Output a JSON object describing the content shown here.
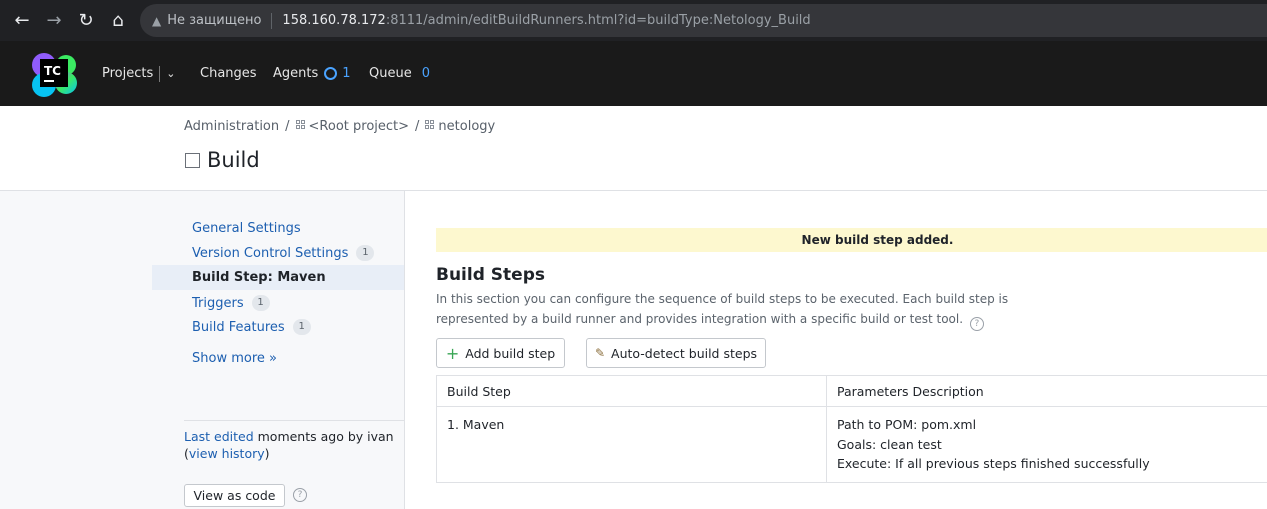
{
  "browser": {
    "insecure_label": "Не защищено",
    "url_host": "158.160.78.172",
    "url_rest": ":8111/admin/editBuildRunners.html?id=buildType:Netology_Build"
  },
  "header": {
    "logo_text": "TC",
    "projects": "Projects",
    "changes": "Changes",
    "agents": "Agents",
    "agents_count": "1",
    "queue": "Queue",
    "queue_count": "0"
  },
  "breadcrumb": {
    "admin": "Administration",
    "sep": "/",
    "root": "<Root project>",
    "project": "netology"
  },
  "page_title": "Build",
  "sidebar": {
    "items": [
      {
        "label": "General Settings",
        "count": ""
      },
      {
        "label": "Version Control Settings",
        "count": "1"
      },
      {
        "label": "Build Step: Maven",
        "count": ""
      },
      {
        "label": "Triggers",
        "count": "1"
      },
      {
        "label": "Build Features",
        "count": "1"
      }
    ],
    "show_more": "Show more »",
    "last_edited_link": "Last edited",
    "last_edited_text": " moments ago by ivan",
    "history_open": "(",
    "history_link": "view history",
    "history_close": ")",
    "view_as_code": "View as code"
  },
  "main": {
    "notice": "New build step added.",
    "heading": "Build Steps",
    "description": "In this section you can configure the sequence of build steps to be executed. Each build step is represented by a build runner and provides integration with a specific build or test tool.",
    "add_step": "Add build step",
    "auto_detect": "Auto-detect build steps",
    "table": {
      "col_step": "Build Step",
      "col_params": "Parameters Description",
      "rows": [
        {
          "step": "1. Maven",
          "params": [
            "Path to POM: pom.xml",
            "Goals: clean test",
            "Execute: If all previous steps finished successfully"
          ]
        }
      ]
    }
  }
}
